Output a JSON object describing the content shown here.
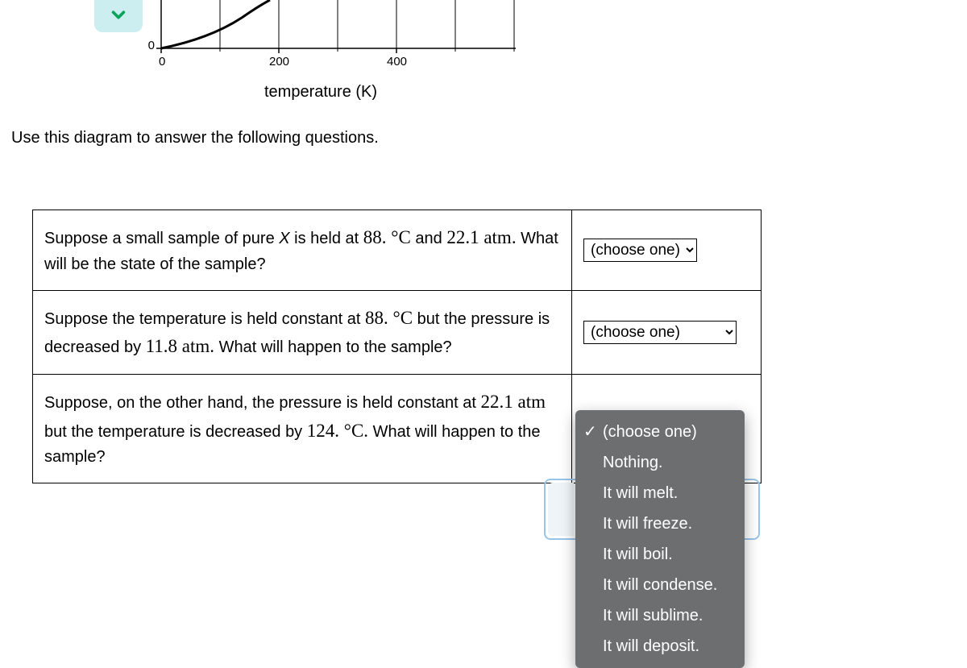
{
  "chart_data": {
    "type": "line",
    "xlabel": "temperature (K)",
    "x_ticks": [
      0,
      200,
      400
    ],
    "y_ticks_visible": [
      0
    ],
    "xlim": [
      0,
      600
    ],
    "note": "Only lower-left fragment of a phase diagram is visible; a single curve rises from near origin toward upper right.",
    "series": [
      {
        "name": "phase-boundary",
        "x": [
          0,
          60,
          120,
          180
        ],
        "y": [
          0,
          10,
          28,
          60
        ]
      }
    ]
  },
  "icons": {
    "collapse": "chevron-down"
  },
  "instruction": "Use this diagram to answer the following questions.",
  "questions": {
    "q1": {
      "pre": "Suppose a small sample of pure ",
      "var": "X",
      "mid1": " is held at ",
      "val1": "88.",
      "unit1": " °C",
      "mid2": " and ",
      "val2": "22.1",
      "unit2": " atm.",
      "post": " What will be the state of the sample?",
      "answer_placeholder": "(choose one)"
    },
    "q2": {
      "pre": "Suppose the temperature is held constant at ",
      "val1": "88.",
      "unit1": " °C",
      "mid": " but the pressure is decreased by ",
      "val2": "11.8",
      "unit2": " atm.",
      "post": " What will happen to the sample?",
      "answer_placeholder": "(choose one)"
    },
    "q3": {
      "pre": "Suppose, on the other hand, the pressure is held constant at ",
      "val1": "22.1",
      "unit1": " atm",
      "mid": " but the temperature is decreased by ",
      "val2": "124.",
      "unit2": " °C.",
      "post": " What will happen to the sample?",
      "options": [
        "(choose one)",
        "Nothing.",
        "It will melt.",
        "It will freeze.",
        "It will boil.",
        "It will condense.",
        "It will sublime.",
        "It will deposit."
      ],
      "selected_index": 0
    }
  }
}
